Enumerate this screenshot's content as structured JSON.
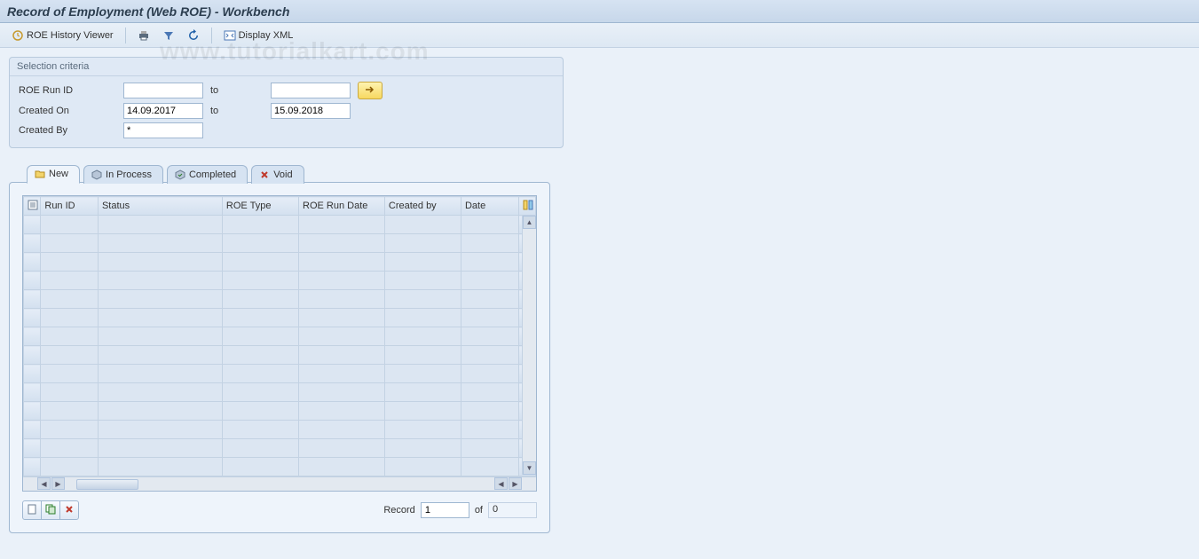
{
  "title": "Record of Employment (Web ROE) - Workbench",
  "watermark": "www.tutorialkart.com",
  "toolbar": {
    "history_viewer": "ROE History Viewer",
    "display_xml": "Display XML"
  },
  "selection": {
    "title": "Selection criteria",
    "labels": {
      "run_id": "ROE Run ID",
      "created_on": "Created On",
      "created_by": "Created By",
      "to": "to"
    },
    "values": {
      "run_id_from": "",
      "run_id_to": "",
      "created_on_from": "14.09.2017",
      "created_on_to": "15.09.2018",
      "created_by": "*"
    }
  },
  "tabs": [
    {
      "id": "new",
      "label": "New",
      "active": true
    },
    {
      "id": "in_process",
      "label": "In Process",
      "active": false
    },
    {
      "id": "completed",
      "label": "Completed",
      "active": false
    },
    {
      "id": "void",
      "label": "Void",
      "active": false
    }
  ],
  "grid": {
    "columns": [
      "Run ID",
      "Status",
      "ROE Type",
      "ROE Run Date",
      "Created by",
      "Date"
    ],
    "row_count": 14
  },
  "footer": {
    "record_label": "Record",
    "record_value": "1",
    "of_label": "of",
    "of_value": "0"
  }
}
